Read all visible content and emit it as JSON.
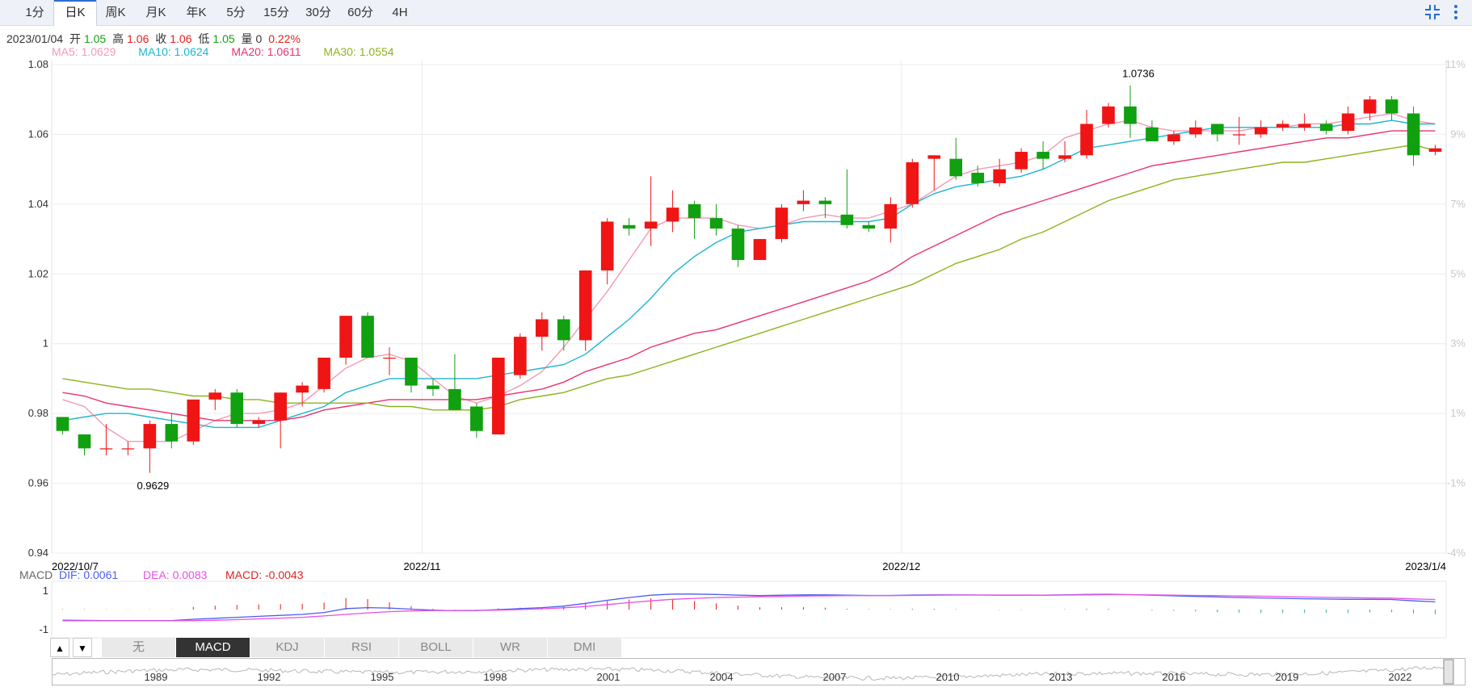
{
  "tabs": [
    "1分",
    "日K",
    "周K",
    "月K",
    "年K",
    "5分",
    "15分",
    "30分",
    "60分",
    "4H"
  ],
  "active_tab": 1,
  "info": {
    "date": "2023/01/04",
    "open_label": "开",
    "open": "1.05",
    "high_label": "高",
    "high": "1.06",
    "close_label": "收",
    "close": "1.06",
    "low_label": "低",
    "low": "1.05",
    "vol_label": "量",
    "vol": "0",
    "change": "0.22%"
  },
  "ma_legend": [
    {
      "text": "MA5: 1.0629",
      "color": "#f39ab5"
    },
    {
      "text": "MA10: 1.0624",
      "color": "#1fb4d2"
    },
    {
      "text": "MA20: 1.0611",
      "color": "#e8336d"
    },
    {
      "text": "MA30: 1.0554",
      "color": "#8cb31b"
    }
  ],
  "macd_legend": {
    "title": "MACD",
    "dif": "DIF: 0.0061",
    "dea": "DEA: 0.0083",
    "macd": "MACD: -0.0043"
  },
  "indicator_tabs": [
    "无",
    "MACD",
    "KDJ",
    "RSI",
    "BOLL",
    "WR",
    "DMI"
  ],
  "active_indicator": 1,
  "arrows": {
    "up": "▲",
    "down": "▼"
  },
  "colors": {
    "up": "#f01515",
    "down": "#10a010",
    "dif": "#4a5ef0",
    "dea": "#ea4ee8",
    "grid": "#ececec"
  },
  "icons": {
    "compress": "compress-icon",
    "more": "more-vertical-icon"
  },
  "chart_data": {
    "type": "candlestick",
    "date_ticks": [
      {
        "label": "2022/10/7",
        "index": 0
      },
      {
        "label": "2022/11",
        "index": 17
      },
      {
        "label": "2022/12",
        "index": 39
      },
      {
        "label": "2023/1/4",
        "index": 63
      }
    ],
    "y_ticks": [
      "1.08",
      "1.06",
      "1.04",
      "1.02",
      "1",
      "0.98",
      "0.96",
      "0.94"
    ],
    "ylim": [
      0.94,
      1.08
    ],
    "pct_ticks": [
      "11%",
      "9%",
      "7%",
      "5%",
      "3%",
      "1%",
      "-1%",
      "-4%"
    ],
    "annotations": [
      {
        "text": "0.9629",
        "index": 4,
        "value": 0.9629,
        "pos": "below"
      },
      {
        "text": "1.0736",
        "index": 49,
        "value": 1.0736,
        "pos": "above"
      }
    ],
    "candles": [
      [
        0.979,
        0.975,
        0.979,
        0.974
      ],
      [
        0.974,
        0.97,
        0.974,
        0.968
      ],
      [
        0.97,
        0.97,
        0.977,
        0.968
      ],
      [
        0.97,
        0.97,
        0.972,
        0.968
      ],
      [
        0.97,
        0.977,
        0.978,
        0.963
      ],
      [
        0.977,
        0.972,
        0.98,
        0.97
      ],
      [
        0.972,
        0.984,
        0.984,
        0.971
      ],
      [
        0.984,
        0.986,
        0.987,
        0.981
      ],
      [
        0.986,
        0.977,
        0.987,
        0.976
      ],
      [
        0.977,
        0.978,
        0.979,
        0.976
      ],
      [
        0.978,
        0.986,
        0.986,
        0.97
      ],
      [
        0.986,
        0.988,
        0.989,
        0.982
      ],
      [
        0.987,
        0.996,
        0.996,
        0.986
      ],
      [
        0.996,
        1.008,
        1.008,
        0.994
      ],
      [
        1.008,
        0.996,
        1.009,
        0.996
      ],
      [
        0.996,
        0.996,
        0.999,
        0.991
      ],
      [
        0.996,
        0.988,
        0.996,
        0.986
      ],
      [
        0.988,
        0.987,
        0.99,
        0.985
      ],
      [
        0.987,
        0.981,
        0.997,
        0.981
      ],
      [
        0.982,
        0.975,
        0.983,
        0.973
      ],
      [
        0.974,
        0.996,
        0.996,
        0.974
      ],
      [
        0.991,
        1.002,
        1.003,
        0.99
      ],
      [
        1.002,
        1.007,
        1.009,
        0.998
      ],
      [
        1.007,
        1.001,
        1.008,
        0.998
      ],
      [
        1.001,
        1.021,
        1.021,
        0.998
      ],
      [
        1.021,
        1.035,
        1.036,
        1.017
      ],
      [
        1.034,
        1.033,
        1.036,
        1.031
      ],
      [
        1.033,
        1.035,
        1.048,
        1.028
      ],
      [
        1.035,
        1.039,
        1.044,
        1.032
      ],
      [
        1.04,
        1.036,
        1.041,
        1.03
      ],
      [
        1.036,
        1.033,
        1.04,
        1.031
      ],
      [
        1.033,
        1.024,
        1.034,
        1.022
      ],
      [
        1.024,
        1.03,
        1.03,
        1.024
      ],
      [
        1.03,
        1.039,
        1.04,
        1.029
      ],
      [
        1.04,
        1.041,
        1.044,
        1.038
      ],
      [
        1.041,
        1.04,
        1.042,
        1.036
      ],
      [
        1.037,
        1.034,
        1.05,
        1.033
      ],
      [
        1.034,
        1.033,
        1.035,
        1.032
      ],
      [
        1.033,
        1.04,
        1.042,
        1.029
      ],
      [
        1.04,
        1.052,
        1.053,
        1.039
      ],
      [
        1.053,
        1.054,
        1.054,
        1.044
      ],
      [
        1.053,
        1.048,
        1.059,
        1.047
      ],
      [
        1.049,
        1.046,
        1.051,
        1.045
      ],
      [
        1.046,
        1.05,
        1.053,
        1.045
      ],
      [
        1.05,
        1.055,
        1.056,
        1.049
      ],
      [
        1.055,
        1.053,
        1.058,
        1.05
      ],
      [
        1.053,
        1.054,
        1.058,
        1.052
      ],
      [
        1.054,
        1.063,
        1.067,
        1.053
      ],
      [
        1.063,
        1.068,
        1.069,
        1.062
      ],
      [
        1.068,
        1.063,
        1.074,
        1.059
      ],
      [
        1.062,
        1.058,
        1.064,
        1.058
      ],
      [
        1.058,
        1.06,
        1.061,
        1.057
      ],
      [
        1.06,
        1.062,
        1.064,
        1.059
      ],
      [
        1.063,
        1.06,
        1.063,
        1.058
      ],
      [
        1.06,
        1.06,
        1.065,
        1.057
      ],
      [
        1.06,
        1.062,
        1.064,
        1.059
      ],
      [
        1.062,
        1.063,
        1.064,
        1.061
      ],
      [
        1.062,
        1.063,
        1.066,
        1.061
      ],
      [
        1.063,
        1.061,
        1.064,
        1.06
      ],
      [
        1.061,
        1.066,
        1.068,
        1.06
      ],
      [
        1.066,
        1.07,
        1.071,
        1.064
      ],
      [
        1.07,
        1.066,
        1.071,
        1.064
      ],
      [
        1.066,
        1.054,
        1.068,
        1.051
      ],
      [
        1.055,
        1.056,
        1.057,
        1.054
      ]
    ],
    "ma": [
      {
        "name": "MA5",
        "color": "#f39ab5",
        "values": [
          0.984,
          0.982,
          0.976,
          0.972,
          0.972,
          0.972,
          0.975,
          0.978,
          0.98,
          0.98,
          0.981,
          0.983,
          0.988,
          0.993,
          0.996,
          0.997,
          0.995,
          0.99,
          0.985,
          0.983,
          0.985,
          0.988,
          0.992,
          0.999,
          1.007,
          1.015,
          1.024,
          1.033,
          1.036,
          1.036,
          1.036,
          1.034,
          1.033,
          1.034,
          1.036,
          1.037,
          1.036,
          1.036,
          1.038,
          1.04,
          1.044,
          1.048,
          1.05,
          1.051,
          1.052,
          1.054,
          1.059,
          1.061,
          1.063,
          1.064,
          1.062,
          1.061,
          1.061,
          1.061,
          1.061,
          1.062,
          1.062,
          1.063,
          1.063,
          1.064,
          1.065,
          1.066,
          1.064,
          1.063
        ]
      },
      {
        "name": "MA10",
        "color": "#1fb4d2",
        "values": [
          0.978,
          0.979,
          0.98,
          0.98,
          0.979,
          0.978,
          0.977,
          0.976,
          0.976,
          0.976,
          0.978,
          0.98,
          0.982,
          0.986,
          0.988,
          0.99,
          0.99,
          0.99,
          0.99,
          0.99,
          0.991,
          0.992,
          0.993,
          0.994,
          0.997,
          1.002,
          1.007,
          1.013,
          1.02,
          1.025,
          1.029,
          1.032,
          1.033,
          1.034,
          1.035,
          1.035,
          1.035,
          1.035,
          1.036,
          1.04,
          1.043,
          1.045,
          1.046,
          1.047,
          1.048,
          1.05,
          1.053,
          1.056,
          1.057,
          1.058,
          1.059,
          1.06,
          1.061,
          1.062,
          1.062,
          1.062,
          1.062,
          1.062,
          1.062,
          1.063,
          1.063,
          1.064,
          1.063,
          1.063
        ]
      },
      {
        "name": "MA20",
        "color": "#e8336d",
        "values": [
          0.986,
          0.985,
          0.983,
          0.982,
          0.981,
          0.98,
          0.979,
          0.978,
          0.978,
          0.978,
          0.978,
          0.979,
          0.981,
          0.982,
          0.983,
          0.984,
          0.984,
          0.984,
          0.984,
          0.984,
          0.985,
          0.986,
          0.987,
          0.989,
          0.992,
          0.994,
          0.996,
          0.999,
          1.001,
          1.003,
          1.004,
          1.006,
          1.008,
          1.01,
          1.012,
          1.014,
          1.016,
          1.018,
          1.021,
          1.025,
          1.028,
          1.031,
          1.034,
          1.037,
          1.039,
          1.041,
          1.043,
          1.045,
          1.047,
          1.049,
          1.051,
          1.052,
          1.053,
          1.054,
          1.055,
          1.056,
          1.057,
          1.058,
          1.059,
          1.059,
          1.06,
          1.061,
          1.061,
          1.061
        ]
      },
      {
        "name": "MA30",
        "color": "#8cb31b",
        "values": [
          0.99,
          0.989,
          0.988,
          0.987,
          0.987,
          0.986,
          0.985,
          0.985,
          0.984,
          0.984,
          0.983,
          0.983,
          0.983,
          0.983,
          0.983,
          0.982,
          0.982,
          0.981,
          0.981,
          0.981,
          0.982,
          0.984,
          0.985,
          0.986,
          0.988,
          0.99,
          0.991,
          0.993,
          0.995,
          0.997,
          0.999,
          1.001,
          1.003,
          1.005,
          1.007,
          1.009,
          1.011,
          1.013,
          1.015,
          1.017,
          1.02,
          1.023,
          1.025,
          1.027,
          1.03,
          1.032,
          1.035,
          1.038,
          1.041,
          1.043,
          1.045,
          1.047,
          1.048,
          1.049,
          1.05,
          1.051,
          1.052,
          1.052,
          1.053,
          1.054,
          1.055,
          1.056,
          1.057,
          1.0554
        ]
      }
    ],
    "macd": {
      "ylim": [
        -1,
        1
      ],
      "y_ticks": [
        "1",
        "-1"
      ],
      "dif": [
        -0.55,
        -0.56,
        -0.57,
        -0.57,
        -0.57,
        -0.57,
        -0.5,
        -0.45,
        -0.4,
        -0.35,
        -0.3,
        -0.25,
        -0.15,
        0.05,
        0.1,
        0.08,
        0.02,
        -0.03,
        -0.06,
        -0.05,
        0.0,
        0.05,
        0.1,
        0.18,
        0.32,
        0.48,
        0.62,
        0.74,
        0.8,
        0.8,
        0.78,
        0.74,
        0.72,
        0.74,
        0.76,
        0.76,
        0.74,
        0.73,
        0.73,
        0.75,
        0.76,
        0.76,
        0.75,
        0.74,
        0.74,
        0.74,
        0.76,
        0.78,
        0.79,
        0.77,
        0.74,
        0.71,
        0.68,
        0.65,
        0.62,
        0.6,
        0.58,
        0.56,
        0.54,
        0.53,
        0.53,
        0.52,
        0.45,
        0.4
      ],
      "dea": [
        -0.58,
        -0.58,
        -0.58,
        -0.58,
        -0.58,
        -0.58,
        -0.57,
        -0.55,
        -0.52,
        -0.48,
        -0.44,
        -0.4,
        -0.33,
        -0.25,
        -0.17,
        -0.11,
        -0.07,
        -0.05,
        -0.05,
        -0.04,
        -0.03,
        0.0,
        0.04,
        0.09,
        0.16,
        0.26,
        0.36,
        0.45,
        0.53,
        0.58,
        0.62,
        0.64,
        0.66,
        0.68,
        0.7,
        0.71,
        0.72,
        0.72,
        0.72,
        0.73,
        0.74,
        0.75,
        0.75,
        0.75,
        0.75,
        0.74,
        0.75,
        0.76,
        0.77,
        0.77,
        0.76,
        0.74,
        0.73,
        0.72,
        0.7,
        0.69,
        0.67,
        0.65,
        0.63,
        0.62,
        0.6,
        0.59,
        0.55,
        0.52
      ],
      "hist": [
        0.02,
        0.02,
        0.01,
        0.01,
        0.01,
        0.01,
        0.14,
        0.2,
        0.24,
        0.26,
        0.28,
        0.3,
        0.36,
        0.6,
        0.54,
        0.38,
        0.18,
        0.04,
        -0.02,
        -0.02,
        0.06,
        0.1,
        0.12,
        0.18,
        0.32,
        0.44,
        0.52,
        0.58,
        0.54,
        0.44,
        0.32,
        0.2,
        0.12,
        0.12,
        0.12,
        0.1,
        0.04,
        0.02,
        0.02,
        0.04,
        0.04,
        0.02,
        0.0,
        -0.02,
        -0.02,
        0.0,
        0.02,
        0.04,
        0.04,
        0.0,
        -0.04,
        -0.06,
        -0.1,
        -0.14,
        -0.16,
        -0.18,
        -0.18,
        -0.18,
        -0.18,
        -0.18,
        -0.14,
        -0.14,
        -0.2,
        -0.24
      ]
    },
    "navigator": {
      "years": [
        "1989",
        "1992",
        "1995",
        "1998",
        "2001",
        "2004",
        "2007",
        "2010",
        "2013",
        "2016",
        "2019",
        "2022"
      ]
    }
  }
}
